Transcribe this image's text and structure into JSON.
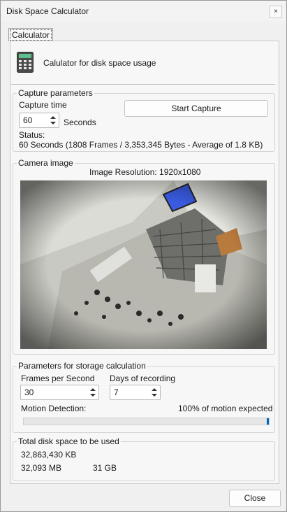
{
  "window": {
    "title": "Disk Space Calculator",
    "close_glyph": "×"
  },
  "tab": {
    "label": "Calculator"
  },
  "intro": {
    "icon": "calculator-icon",
    "text": "Calulator for disk space usage"
  },
  "capture": {
    "group_label": "Capture parameters",
    "time_label": "Capture time",
    "time_value": "60",
    "time_unit": "Seconds",
    "start_button": "Start Capture",
    "status_label": "Status:",
    "status_text": "60 Seconds (1808 Frames / 3,353,345 Bytes - Average of 1.8 KB)"
  },
  "camera": {
    "group_label": "Camera image",
    "resolution": "Image Resolution: 1920x1080"
  },
  "storage": {
    "group_label": "Parameters for storage calculation",
    "fps_label": "Frames per Second",
    "fps_value": "30",
    "days_label": "Days of recording",
    "days_value": "7",
    "motion_label": "Motion Detection:",
    "motion_value_text": "100% of motion expected",
    "motion_percent": 100
  },
  "total": {
    "group_label": "Total disk space to be used",
    "kb": "32,863,430 KB",
    "mb": "32,093 MB",
    "gb": "31 GB"
  },
  "footer": {
    "close_button": "Close"
  },
  "colors": {
    "accent": "#0067c0",
    "screen": "#3a5be0"
  }
}
